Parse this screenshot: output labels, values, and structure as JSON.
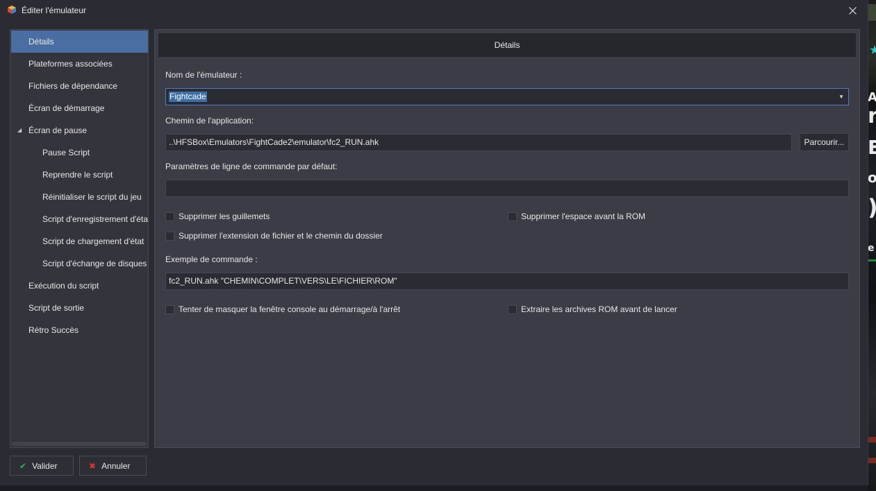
{
  "window": {
    "title": "Éditer l'émulateur"
  },
  "sidebar": {
    "items": [
      {
        "label": "Détails"
      },
      {
        "label": "Plateformes associées"
      },
      {
        "label": "Fichiers de dépendance"
      },
      {
        "label": "Écran de démarrage"
      },
      {
        "label": "Écran de pause"
      },
      {
        "label": "Pause Script"
      },
      {
        "label": "Reprendre le script"
      },
      {
        "label": "Réinitialiser le script du jeu"
      },
      {
        "label": "Script d'enregistrement d'état"
      },
      {
        "label": "Script de chargement d'état"
      },
      {
        "label": "Script d'échange de disques"
      },
      {
        "label": "Exécution du script"
      },
      {
        "label": "Script de sortie"
      },
      {
        "label": "Rétro Succès"
      }
    ],
    "selected": "Détails",
    "expanded": "Écran de pause"
  },
  "content": {
    "header": "Détails",
    "emulator_name": {
      "label": "Nom de l'émulateur :",
      "value": "Fightcade"
    },
    "app_path": {
      "label": "Chemin de l'application:",
      "value": "..\\HFSBox\\Emulators\\FightCade2\\emulator\\fc2_RUN.ahk",
      "browse_label": "Parcourir..."
    },
    "cmdline": {
      "label": "Paramètres de ligne de commande par défaut:",
      "value": ""
    },
    "checkboxes": {
      "remove_quotes": {
        "label": "Supprimer les guillemets",
        "checked": false
      },
      "remove_space": {
        "label": "Supprimer l'espace avant la ROM",
        "checked": false
      },
      "remove_ext": {
        "label": "Supprimer l'extension de fichier et le chemin du dossier",
        "checked": false
      },
      "hide_console": {
        "label": "Tenter de masquer la fenêtre console au démarrage/à l'arrêt",
        "checked": false
      },
      "extract_rom": {
        "label": "Extraire les archives ROM avant de lancer",
        "checked": false
      }
    },
    "example": {
      "label": "Exemple de commande :",
      "value": "fc2_RUN.ahk \"CHEMIN\\COMPLET\\VERS\\LE\\FICHIER\\ROM\""
    }
  },
  "footer": {
    "ok_label": "Valider",
    "cancel_label": "Annuler"
  },
  "colors": {
    "window_bg": "#2b2c33",
    "panel_bg": "#3b3c45",
    "selection": "#4a6da2",
    "focus_border": "#4d7fc4",
    "ok_icon": "#2fb84e",
    "cancel_icon": "#d83434"
  },
  "icons": {
    "app": "app-cube-icon",
    "close": "close-icon",
    "combo_arrow": "chevron-down-icon",
    "expander": "triangle-expanded-icon",
    "ok": "checkmark-icon",
    "cancel": "cross-icon"
  }
}
